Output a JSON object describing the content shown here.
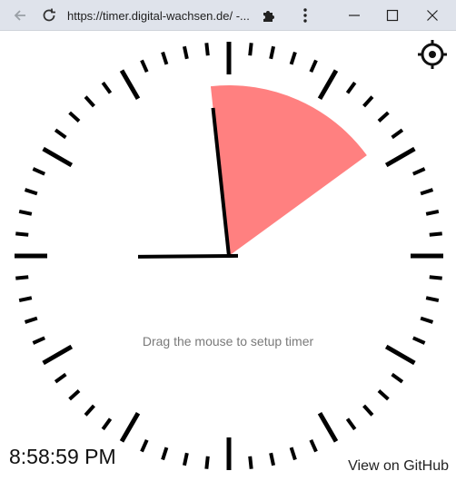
{
  "browser": {
    "url": "https://timer.digital-wachsen.de/ -...",
    "icons": [
      "back-arrow-icon",
      "reload-icon",
      "puzzle-extension-icon",
      "kebab-menu-icon",
      "minimize-icon",
      "maximize-icon",
      "close-icon"
    ]
  },
  "timer": {
    "hint": "Drag the mouse to setup timer",
    "current_time": "8:58:59 PM",
    "github_link": "View on GitHub",
    "timer_minutes": 10,
    "timer_color": "#ff8080",
    "clock_time": {
      "hours": 8,
      "minutes": 58.98,
      "seconds": 59
    },
    "settings_icon": "gear-icon"
  }
}
